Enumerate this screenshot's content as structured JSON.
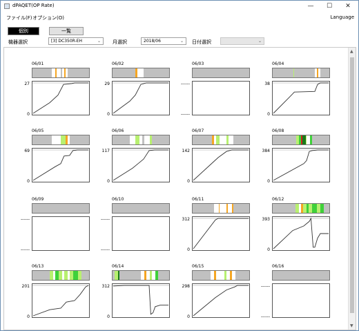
{
  "window": {
    "title": "dPAQET(OP Rate)",
    "minimize": "—",
    "maximize": "☐",
    "close": "✕"
  },
  "menu": {
    "file": "ファイル(F)",
    "options": "オプション(O)",
    "language": "Language"
  },
  "tabs": {
    "individual": "個別",
    "list": "一覧"
  },
  "filters": {
    "device_label": "機器選択",
    "device_value": "[3] DC350R-EH",
    "month_label": "月選択",
    "month_value": "2018/06",
    "date_label": "日付選択",
    "date_value": ""
  },
  "colors": {
    "strip_bg": "#c0c0c0",
    "white": "#ffffff",
    "orange": "#f5a623",
    "light_green": "#b8f070",
    "green": "#3fd13a",
    "dark_green": "#1a7a1a",
    "red": "#d02020",
    "line": "#333333"
  },
  "days": [
    {
      "date": "06/01",
      "ymax": "27",
      "ymin": "0",
      "nodata": false,
      "stripes": [
        [
          0.34,
          0.4,
          "white"
        ],
        [
          0.4,
          0.43,
          "orange"
        ],
        [
          0.43,
          0.5,
          "white"
        ],
        [
          0.52,
          0.56,
          "white"
        ],
        [
          0.56,
          0.58,
          "orange"
        ],
        [
          0.58,
          0.62,
          "white"
        ]
      ],
      "curve": [
        [
          0,
          0
        ],
        [
          0.3,
          0.35
        ],
        [
          0.45,
          0.6
        ],
        [
          0.55,
          0.95
        ],
        [
          0.7,
          0.98
        ],
        [
          0.75,
          1.0
        ],
        [
          1,
          1.0
        ]
      ]
    },
    {
      "date": "06/02",
      "ymax": "29",
      "ymin": "0",
      "nodata": false,
      "stripes": [
        [
          0.4,
          0.44,
          "orange"
        ],
        [
          0.44,
          0.52,
          "white"
        ],
        [
          0.52,
          0.55,
          "white"
        ]
      ],
      "curve": [
        [
          0,
          0
        ],
        [
          0.3,
          0.4
        ],
        [
          0.4,
          0.6
        ],
        [
          0.5,
          0.95
        ],
        [
          0.6,
          1.0
        ],
        [
          1,
          1.0
        ]
      ]
    },
    {
      "date": "06/03",
      "ymax": "------",
      "ymin": "------",
      "nodata": true,
      "stripes": [],
      "curve": []
    },
    {
      "date": "06/04",
      "ymax": "38",
      "ymin": "0",
      "nodata": false,
      "stripes": [
        [
          0.36,
          0.38,
          "light_green"
        ],
        [
          0.74,
          0.78,
          "white"
        ],
        [
          0.78,
          0.8,
          "orange"
        ],
        [
          0.8,
          0.84,
          "white"
        ]
      ],
      "curve": [
        [
          0,
          0
        ],
        [
          0.3,
          0.55
        ],
        [
          0.38,
          0.7
        ],
        [
          0.75,
          0.72
        ],
        [
          0.8,
          0.95
        ],
        [
          0.85,
          1.0
        ],
        [
          1,
          1.0
        ]
      ]
    },
    {
      "date": "06/05",
      "ymax": "69",
      "ymin": "0",
      "nodata": false,
      "stripes": [
        [
          0.34,
          0.44,
          "white"
        ],
        [
          0.44,
          0.5,
          "white"
        ],
        [
          0.5,
          0.58,
          "light_green"
        ],
        [
          0.58,
          0.62,
          "orange"
        ],
        [
          0.62,
          0.66,
          "white"
        ]
      ],
      "curve": [
        [
          0,
          0
        ],
        [
          0.4,
          0.45
        ],
        [
          0.5,
          0.55
        ],
        [
          0.56,
          0.8
        ],
        [
          0.66,
          0.82
        ],
        [
          0.72,
          0.98
        ],
        [
          0.8,
          1.0
        ],
        [
          1,
          1.0
        ]
      ]
    },
    {
      "date": "06/06",
      "ymax": "117",
      "ymin": "0",
      "nodata": false,
      "stripes": [
        [
          0.3,
          0.4,
          "white"
        ],
        [
          0.4,
          0.48,
          "light_green"
        ],
        [
          0.48,
          0.52,
          "white"
        ],
        [
          0.56,
          0.66,
          "white"
        ],
        [
          0.66,
          0.7,
          "light_green"
        ]
      ],
      "curve": [
        [
          0,
          0
        ],
        [
          0.35,
          0.4
        ],
        [
          0.45,
          0.55
        ],
        [
          0.55,
          0.7
        ],
        [
          0.65,
          0.98
        ],
        [
          0.75,
          1.0
        ],
        [
          1,
          1.0
        ]
      ]
    },
    {
      "date": "06/07",
      "ymax": "142",
      "ymin": "0",
      "nodata": false,
      "stripes": [
        [
          0.34,
          0.38,
          "orange"
        ],
        [
          0.38,
          0.42,
          "white"
        ],
        [
          0.42,
          0.48,
          "light_green"
        ],
        [
          0.48,
          0.54,
          "white"
        ],
        [
          0.54,
          0.6,
          "white"
        ],
        [
          0.6,
          0.64,
          "light_green"
        ],
        [
          0.64,
          0.72,
          "white"
        ]
      ],
      "curve": [
        [
          0,
          0
        ],
        [
          0.3,
          0.5
        ],
        [
          0.45,
          0.75
        ],
        [
          0.6,
          0.95
        ],
        [
          0.7,
          1.0
        ],
        [
          1,
          1.0
        ]
      ]
    },
    {
      "date": "06/08",
      "ymax": "384",
      "ymin": "0",
      "nodata": false,
      "stripes": [
        [
          0.42,
          0.46,
          "light_green"
        ],
        [
          0.46,
          0.5,
          "green"
        ],
        [
          0.5,
          0.52,
          "red"
        ],
        [
          0.52,
          0.58,
          "dark_green"
        ],
        [
          0.58,
          0.6,
          "light_green"
        ],
        [
          0.6,
          0.66,
          "white"
        ],
        [
          0.66,
          0.7,
          "green"
        ]
      ],
      "curve": [
        [
          0,
          0
        ],
        [
          0.55,
          0.55
        ],
        [
          0.6,
          0.65
        ],
        [
          0.65,
          0.95
        ],
        [
          0.7,
          0.98
        ],
        [
          0.8,
          1.0
        ],
        [
          1,
          1.0
        ]
      ]
    },
    {
      "date": "06/09",
      "ymax": "------",
      "ymin": "------",
      "nodata": true,
      "stripes": [],
      "curve": []
    },
    {
      "date": "06/10",
      "ymax": "------",
      "ymin": "------",
      "nodata": true,
      "stripes": [],
      "curve": []
    },
    {
      "date": "06/11",
      "ymax": "312",
      "ymin": "0",
      "nodata": false,
      "stripes": [
        [
          0.38,
          0.46,
          "white"
        ],
        [
          0.46,
          0.48,
          "orange"
        ],
        [
          0.48,
          0.56,
          "white"
        ],
        [
          0.56,
          0.6,
          "white"
        ],
        [
          0.6,
          0.62,
          "orange"
        ],
        [
          0.62,
          0.66,
          "white"
        ],
        [
          0.66,
          0.7,
          "white"
        ],
        [
          0.7,
          0.72,
          "orange"
        ]
      ],
      "curve": [
        [
          0,
          0
        ],
        [
          0.4,
          0.95
        ],
        [
          0.45,
          1.0
        ],
        [
          0.75,
          1.0
        ],
        [
          1,
          1.0
        ]
      ]
    },
    {
      "date": "06/12",
      "ymax": "393",
      "ymin": "0",
      "nodata": false,
      "stripes": [
        [
          0.4,
          0.46,
          "light_green"
        ],
        [
          0.46,
          0.5,
          "white"
        ],
        [
          0.5,
          0.54,
          "orange"
        ],
        [
          0.54,
          0.6,
          "light_green"
        ],
        [
          0.6,
          0.64,
          "green"
        ],
        [
          0.64,
          0.7,
          "light_green"
        ],
        [
          0.7,
          0.78,
          "green"
        ],
        [
          0.78,
          0.84,
          "light_green"
        ],
        [
          0.84,
          0.9,
          "green"
        ]
      ],
      "curve": [
        [
          0,
          0
        ],
        [
          0.35,
          0.6
        ],
        [
          0.55,
          0.75
        ],
        [
          0.65,
          0.9
        ],
        [
          0.68,
          1.0
        ],
        [
          0.72,
          0.05
        ],
        [
          0.75,
          0.05
        ],
        [
          0.8,
          0.35
        ],
        [
          0.85,
          0.5
        ],
        [
          1,
          0.5
        ]
      ]
    },
    {
      "date": "06/13",
      "ymax": "201",
      "ymin": "0",
      "nodata": false,
      "stripes": [
        [
          0.3,
          0.36,
          "light_green"
        ],
        [
          0.36,
          0.4,
          "white"
        ],
        [
          0.4,
          0.46,
          "green"
        ],
        [
          0.46,
          0.52,
          "light_green"
        ],
        [
          0.52,
          0.56,
          "white"
        ],
        [
          0.56,
          0.62,
          "light_green"
        ],
        [
          0.62,
          0.66,
          "white"
        ],
        [
          0.66,
          0.72,
          "light_green"
        ],
        [
          0.72,
          0.8,
          "green"
        ],
        [
          0.8,
          0.86,
          "light_green"
        ]
      ],
      "curve": [
        [
          0,
          0
        ],
        [
          0.3,
          0.2
        ],
        [
          0.5,
          0.25
        ],
        [
          0.6,
          0.45
        ],
        [
          0.75,
          0.5
        ],
        [
          0.85,
          0.7
        ],
        [
          0.95,
          0.95
        ],
        [
          1,
          1.0
        ]
      ]
    },
    {
      "date": "06/14",
      "ymax": "312",
      "ymin": "0",
      "nodata": false,
      "stripes": [
        [
          0.04,
          0.1,
          "light_green"
        ],
        [
          0.1,
          0.12,
          "dark_green"
        ],
        [
          0.5,
          0.56,
          "white"
        ],
        [
          0.56,
          0.6,
          "orange"
        ],
        [
          0.6,
          0.66,
          "white"
        ],
        [
          0.66,
          0.7,
          "light_green"
        ],
        [
          0.7,
          0.76,
          "white"
        ],
        [
          0.76,
          0.8,
          "green"
        ]
      ],
      "curve": [
        [
          0,
          0.98
        ],
        [
          0.2,
          1.0
        ],
        [
          0.65,
          1.0
        ],
        [
          0.68,
          0.05
        ],
        [
          0.72,
          0.1
        ],
        [
          0.76,
          0.3
        ],
        [
          0.85,
          0.35
        ],
        [
          1,
          0.35
        ]
      ]
    },
    {
      "date": "06/15",
      "ymax": "298",
      "ymin": "0",
      "nodata": false,
      "stripes": [
        [
          0.32,
          0.38,
          "white"
        ],
        [
          0.38,
          0.42,
          "orange"
        ],
        [
          0.42,
          0.5,
          "white"
        ],
        [
          0.5,
          0.56,
          "white"
        ],
        [
          0.56,
          0.6,
          "light_green"
        ],
        [
          0.6,
          0.66,
          "white"
        ],
        [
          0.66,
          0.7,
          "orange"
        ],
        [
          0.7,
          0.76,
          "white"
        ]
      ],
      "curve": [
        [
          0,
          0
        ],
        [
          0.4,
          0.6
        ],
        [
          0.6,
          0.85
        ],
        [
          0.75,
          0.95
        ],
        [
          0.8,
          1.0
        ],
        [
          1,
          1.0
        ]
      ]
    },
    {
      "date": "06/16",
      "ymax": "------",
      "ymin": "------",
      "nodata": true,
      "stripes": [],
      "curve": []
    }
  ]
}
